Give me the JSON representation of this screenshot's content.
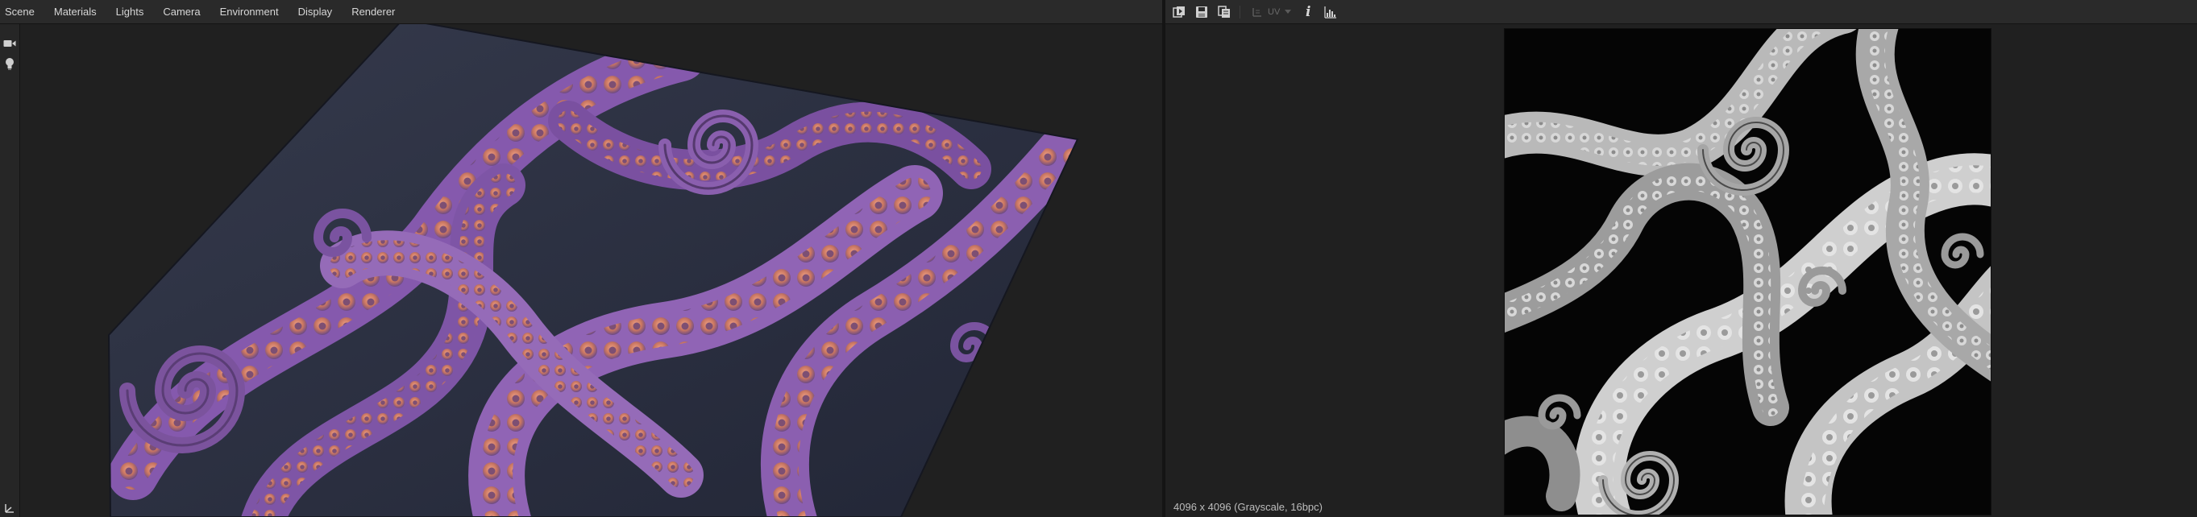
{
  "menubar": {
    "items": [
      "Scene",
      "Materials",
      "Lights",
      "Camera",
      "Environment",
      "Display",
      "Renderer"
    ]
  },
  "side_toolbar": {
    "icons": [
      "camera-icon",
      "light-bulb-icon",
      "axis-gizmo-icon"
    ]
  },
  "viewer_toolbar": {
    "icons": [
      "export-icon",
      "save-icon",
      "copy-icon",
      "uv-channel-icon",
      "info-icon",
      "histogram-icon"
    ],
    "uv_label": "UV"
  },
  "viewer": {
    "image_info": "4096 x 4096 (Grayscale, 16bpc)"
  },
  "colors": {
    "tentacle": "#9a6fc0",
    "sucker": "#d9876e",
    "ground": "#2b3142",
    "heightmap_light": "#d6d6d6",
    "heightmap_dark": "#050505"
  }
}
